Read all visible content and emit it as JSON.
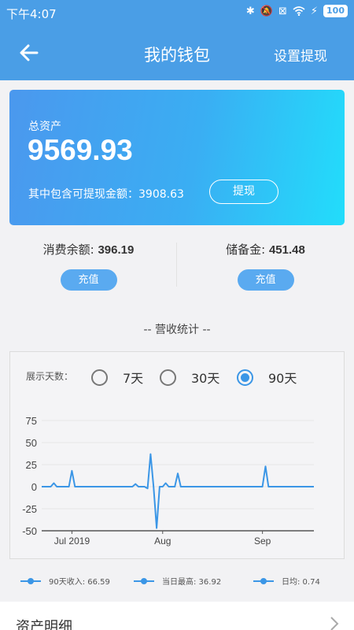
{
  "status_bar": {
    "time": "下午4:07",
    "battery": "100"
  },
  "app_bar": {
    "title": "我的钱包",
    "action": "设置提现"
  },
  "assets": {
    "label": "总资产",
    "total": "9569.93",
    "withdrawable_text": "其中包含可提现金额：3908.63",
    "withdraw_button": "提现"
  },
  "balances": {
    "consume": {
      "label": "消费余额: ",
      "value": "396.19",
      "button": "充值"
    },
    "reserve": {
      "label": "储备金: ",
      "value": "451.48",
      "button": "充值"
    }
  },
  "stats": {
    "title": "-- 营收统计 --",
    "days_label": "展示天数：",
    "options": [
      "7天",
      "30天",
      "90天"
    ],
    "selected": "90天"
  },
  "legend": {
    "income": "90天收入: 66.59",
    "max": "当日最高: 36.92",
    "avg": "日均: 0.74"
  },
  "detail": {
    "label": "资产明细"
  },
  "colors": {
    "primary": "#4a9ee6",
    "line": "#3b96e6",
    "gradient_end": "#22ddfb"
  },
  "chart_data": {
    "type": "line",
    "y_ticks": [
      "75",
      "50",
      "25",
      "0",
      "-25",
      "-50"
    ],
    "x_ticks": [
      "Jul 2019",
      "Aug",
      "Sep"
    ],
    "x_tick_positions": [
      10,
      40,
      73
    ],
    "ylim": [
      -50,
      75
    ],
    "xlim": [
      0,
      90
    ],
    "grid": true,
    "series": [
      {
        "x": [
          0,
          3,
          4,
          5,
          6,
          9,
          10,
          11,
          12,
          30,
          31,
          32,
          34,
          35,
          36,
          37,
          38,
          39,
          40,
          41,
          42,
          44,
          45,
          46,
          47,
          73,
          74,
          75,
          90
        ],
        "values": [
          0,
          0,
          4,
          0,
          0,
          0,
          18,
          0,
          0,
          0,
          3,
          0,
          0,
          -2,
          37,
          0,
          -47,
          0,
          0,
          4,
          0,
          0,
          15,
          0,
          0,
          0,
          23,
          0,
          0
        ]
      }
    ]
  }
}
